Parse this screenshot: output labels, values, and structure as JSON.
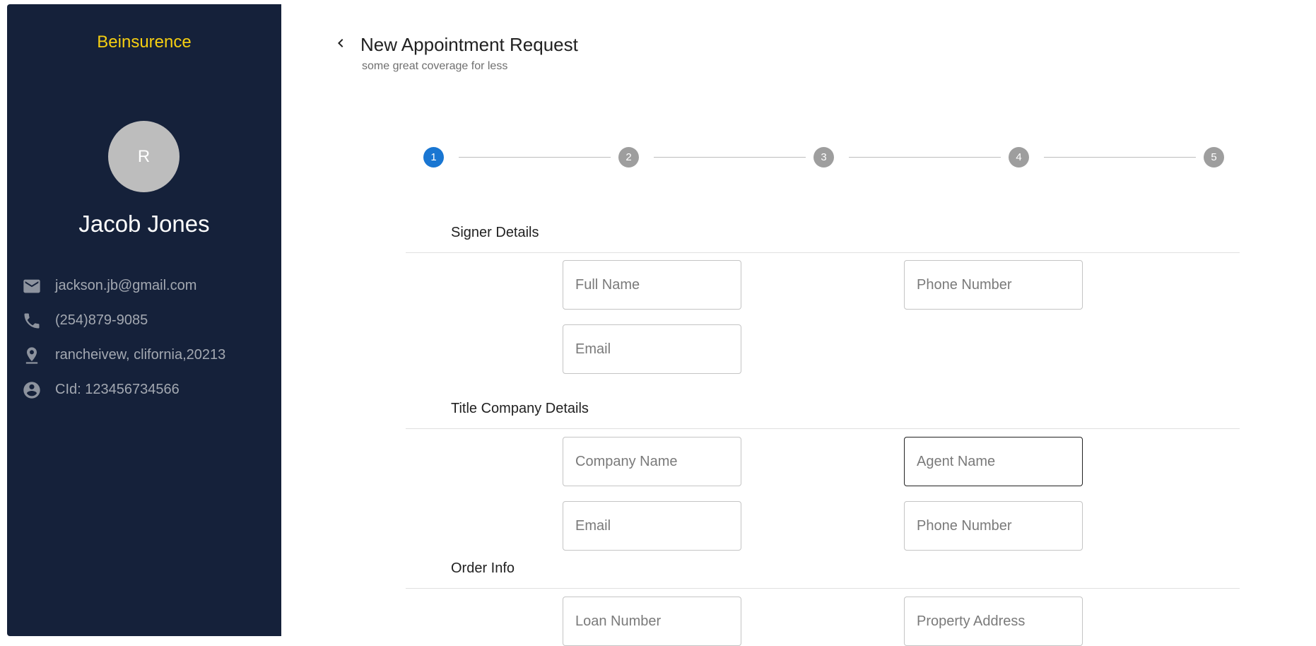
{
  "sidebar": {
    "brand": "Beinsurence",
    "avatar_initial": "R",
    "user_name": "Jacob Jones",
    "info": [
      {
        "icon": "mail-icon",
        "text": "jackson.jb@gmail.com"
      },
      {
        "icon": "phone-icon",
        "text": "(254)879-9085"
      },
      {
        "icon": "location-icon",
        "text": "rancheivew, clifornia,20213"
      },
      {
        "icon": "account-circle-icon",
        "text": "CId: 123456734566"
      }
    ]
  },
  "header": {
    "title": "New Appointment Request",
    "subtitle": "some great coverage for less"
  },
  "stepper": {
    "active_step": 1,
    "steps": [
      "1",
      "2",
      "3",
      "4",
      "5"
    ]
  },
  "sections": {
    "signer": {
      "title": "Signer Details",
      "full_name": {
        "placeholder": "Full Name",
        "value": ""
      },
      "phone": {
        "placeholder": "Phone Number",
        "value": ""
      },
      "email": {
        "placeholder": "Email",
        "value": ""
      }
    },
    "title_company": {
      "title": "Title Company Details",
      "company_name": {
        "placeholder": "Company Name",
        "value": ""
      },
      "agent_name": {
        "placeholder": "Agent Name",
        "value": ""
      },
      "email": {
        "placeholder": "Email",
        "value": ""
      },
      "phone": {
        "placeholder": "Phone Number",
        "value": ""
      }
    },
    "order_info": {
      "title": "Order Info",
      "loan_number": {
        "placeholder": "Loan Number",
        "value": ""
      },
      "property_address": {
        "placeholder": "Property Address",
        "value": ""
      }
    }
  },
  "colors": {
    "sidebar_bg": "#15213a",
    "brand": "#f6cf11",
    "step_active": "#1976d2",
    "step_inactive": "#9e9e9e"
  }
}
